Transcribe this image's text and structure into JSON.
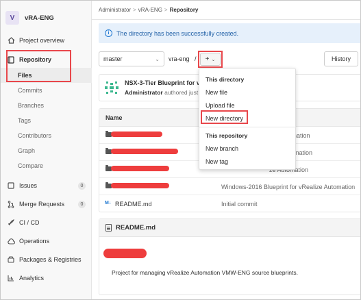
{
  "project": {
    "avatar_letter": "V",
    "name": "vRA-ENG"
  },
  "sidebar": {
    "items": [
      {
        "label": "Project overview",
        "icon": "house-icon"
      },
      {
        "label": "Repository",
        "icon": "book-icon"
      },
      {
        "label": "Issues",
        "icon": "issues-icon",
        "count": "0"
      },
      {
        "label": "Merge Requests",
        "icon": "merge-request-icon",
        "count": "0"
      },
      {
        "label": "CI / CD",
        "icon": "rocket-icon"
      },
      {
        "label": "Operations",
        "icon": "cloud-icon"
      },
      {
        "label": "Packages & Registries",
        "icon": "package-icon"
      },
      {
        "label": "Analytics",
        "icon": "chart-icon"
      }
    ],
    "repo_sub": [
      {
        "label": "Files"
      },
      {
        "label": "Commits"
      },
      {
        "label": "Branches"
      },
      {
        "label": "Tags"
      },
      {
        "label": "Contributors"
      },
      {
        "label": "Graph"
      },
      {
        "label": "Compare"
      }
    ]
  },
  "breadcrumb": {
    "a": "Administrator",
    "b": "vRA-ENG",
    "c": "Repository",
    "sep": ">"
  },
  "alert": {
    "text": "The directory has been successfully created."
  },
  "toolbar": {
    "branch": "master",
    "path": "vra-eng",
    "slash": "/",
    "plus": "+",
    "history": "History"
  },
  "commit": {
    "title": "NSX-3-Tier Blueprint for vRe",
    "author": "Administrator",
    "meta_rest": " authored just n"
  },
  "table": {
    "header_name": "Name",
    "rows": [
      {
        "type": "folder",
        "name": "",
        "message": "Automation"
      },
      {
        "type": "folder",
        "name": "",
        "message": "ealize Automation"
      },
      {
        "type": "folder",
        "name": "",
        "message": "ze Automation"
      },
      {
        "type": "folder",
        "name": "",
        "message": "Windows-2016 Blueprint for vRealize Automation"
      },
      {
        "type": "file",
        "name": "README.md",
        "message": "Initial commit"
      }
    ]
  },
  "readme": {
    "title": "README.md",
    "description": "Project for managing vRealize Automation VMW-ENG source blueprints."
  },
  "dropdown": {
    "section1": "This directory",
    "items1": [
      "New file",
      "Upload file",
      "New directory"
    ],
    "section2": "This repository",
    "items2": [
      "New branch",
      "New tag"
    ]
  },
  "colors": {
    "highlight": "#e8474b",
    "redaction": "#ee3d3d",
    "info_bg": "#e6f0fb",
    "link": "#1f78d1"
  }
}
